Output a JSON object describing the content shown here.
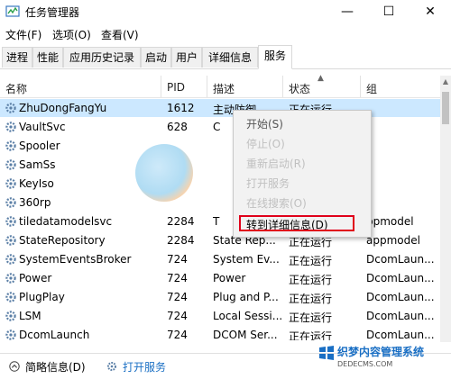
{
  "window": {
    "title": "任务管理器",
    "minimize_glyph": "—",
    "maximize_glyph": "☐",
    "close_glyph": "✕"
  },
  "menu": [
    "文件(F)",
    "选项(O)",
    "查看(V)"
  ],
  "tabs": [
    {
      "label": "进程",
      "active": false
    },
    {
      "label": "性能",
      "active": false
    },
    {
      "label": "应用历史记录",
      "active": false
    },
    {
      "label": "启动",
      "active": false
    },
    {
      "label": "用户",
      "active": false
    },
    {
      "label": "详细信息",
      "active": false
    },
    {
      "label": "服务",
      "active": true
    }
  ],
  "columns": {
    "name": "名称",
    "pid": "PID",
    "desc": "描述",
    "status": "状态",
    "group": "组"
  },
  "rows": [
    {
      "name": "ZhuDongFangYu",
      "pid": "1612",
      "desc": "主动防御",
      "status": "正在运行",
      "group": "",
      "selected": true
    },
    {
      "name": "VaultSvc",
      "pid": "628",
      "desc": "C",
      "status": "",
      "group": ""
    },
    {
      "name": "Spooler",
      "pid": "",
      "desc": "",
      "status": "",
      "group": ""
    },
    {
      "name": "SamSs",
      "pid": "",
      "desc": "",
      "status": "",
      "group": ""
    },
    {
      "name": "KeyIso",
      "pid": "",
      "desc": "",
      "status": "",
      "group": ""
    },
    {
      "name": "360rp",
      "pid": "",
      "desc": "",
      "status": "",
      "group": ""
    },
    {
      "name": "tiledatamodelsvc",
      "pid": "2284",
      "desc": "T",
      "status": "",
      "group": "ppmodel"
    },
    {
      "name": "StateRepository",
      "pid": "2284",
      "desc": "State Rep...",
      "status": "正在运行",
      "group": "appmodel"
    },
    {
      "name": "SystemEventsBroker",
      "pid": "724",
      "desc": "System Ev...",
      "status": "正在运行",
      "group": "DcomLaun..."
    },
    {
      "name": "Power",
      "pid": "724",
      "desc": "Power",
      "status": "正在运行",
      "group": "DcomLaun..."
    },
    {
      "name": "PlugPlay",
      "pid": "724",
      "desc": "Plug and P...",
      "status": "正在运行",
      "group": "DcomLaun..."
    },
    {
      "name": "LSM",
      "pid": "724",
      "desc": "Local Sessi...",
      "status": "正在运行",
      "group": "DcomLaun..."
    },
    {
      "name": "DcomLaunch",
      "pid": "724",
      "desc": "DCOM Ser...",
      "status": "正在运行",
      "group": "DcomLaun..."
    }
  ],
  "context_menu": {
    "items": [
      {
        "label": "开始(S)",
        "style": "normal"
      },
      {
        "label": "停止(O)",
        "style": "blur"
      },
      {
        "label": "重新启动(R)",
        "style": "blur"
      },
      {
        "label": "打开服务",
        "style": "blur"
      },
      {
        "label": "在线搜索(O)",
        "style": "blur"
      },
      {
        "label": "转到详细信息(D)",
        "style": "highlight"
      }
    ],
    "highlight_color": "#e0001a"
  },
  "footer": {
    "summary": "简略信息(D)",
    "open_services": "打开服务"
  },
  "watermark": {
    "line1": "织梦内容管理系统",
    "line2": "DEDECMS.COM"
  },
  "colors": {
    "selected_row": "#cce8ff",
    "gear": "#5b7fa6",
    "link": "#1a6fc4"
  }
}
